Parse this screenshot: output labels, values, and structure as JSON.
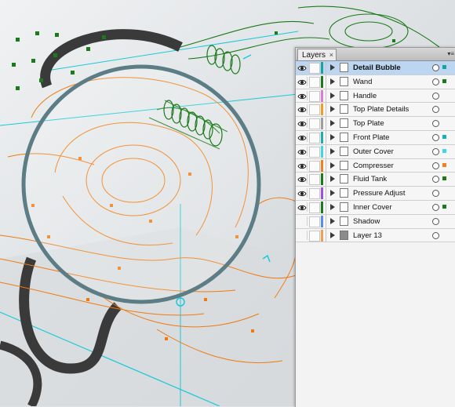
{
  "panel": {
    "tab_label": "Layers",
    "tab_close": "×",
    "menu_glyph": "▾≡"
  },
  "layers": [
    {
      "name": "Detail Bubble",
      "color": "#19a2a2",
      "visible": true,
      "selected": true,
      "thumb": "light",
      "sel_color": "#19a2a2"
    },
    {
      "name": "Wand",
      "color": "#1b7a1b",
      "visible": true,
      "selected": false,
      "thumb": "light",
      "sel_color": "#1b7a1b"
    },
    {
      "name": "Handle",
      "color": "#e07ad8",
      "visible": true,
      "selected": false,
      "thumb": "light",
      "sel_color": ""
    },
    {
      "name": "Top Plate Details",
      "color": "#f0a020",
      "visible": true,
      "selected": false,
      "thumb": "light",
      "sel_color": ""
    },
    {
      "name": "Top Plate",
      "color": "#9e9e9e",
      "visible": true,
      "selected": false,
      "thumb": "light",
      "sel_color": ""
    },
    {
      "name": "Front Plate",
      "color": "#1ab0b0",
      "visible": true,
      "selected": false,
      "thumb": "light",
      "sel_color": "#1ab0b0"
    },
    {
      "name": "Outer Cover",
      "color": "#3fd6e6",
      "visible": true,
      "selected": false,
      "thumb": "light",
      "sel_color": "#3fd6e6"
    },
    {
      "name": "Compresser",
      "color": "#f08020",
      "visible": true,
      "selected": false,
      "thumb": "light",
      "sel_color": "#f08020"
    },
    {
      "name": "Fluid Tank",
      "color": "#1b7a1b",
      "visible": true,
      "selected": false,
      "thumb": "light",
      "sel_color": "#1b7a1b"
    },
    {
      "name": "Pressure Adjust",
      "color": "#a050e0",
      "visible": true,
      "selected": false,
      "thumb": "light",
      "sel_color": ""
    },
    {
      "name": "Inner Cover",
      "color": "#1b7a1b",
      "visible": true,
      "selected": false,
      "thumb": "light",
      "sel_color": "#1b7a1b"
    },
    {
      "name": "Shadow",
      "color": "#5a8cf0",
      "visible": false,
      "selected": false,
      "thumb": "light",
      "sel_color": ""
    },
    {
      "name": "Layer 13",
      "color": "#f0a050",
      "visible": false,
      "selected": false,
      "thumb": "dark",
      "sel_color": ""
    }
  ]
}
